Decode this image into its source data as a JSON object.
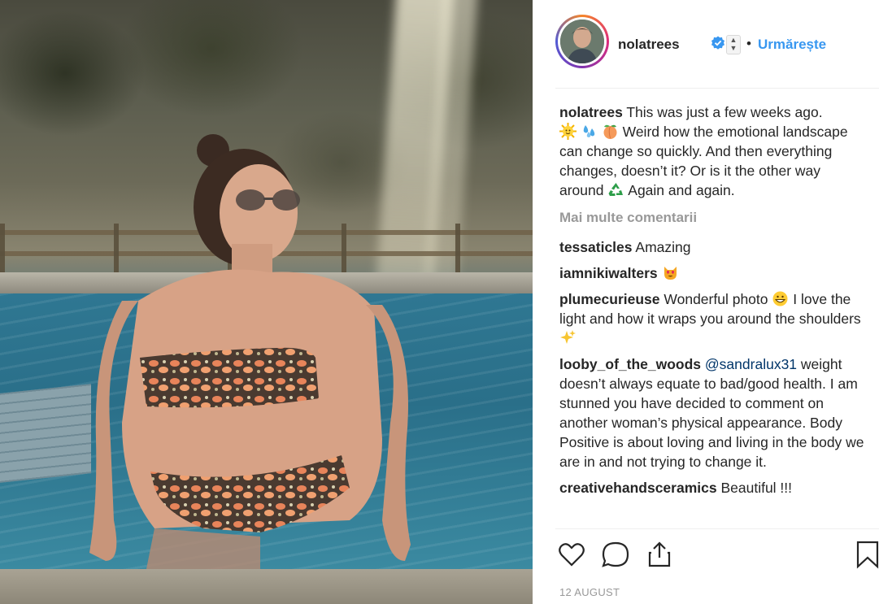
{
  "post": {
    "photo_alt": "",
    "author": {
      "username": "nolatrees",
      "verified": true,
      "follow_label": "Urmărește",
      "separator": "•"
    },
    "caption": {
      "username": "nolatrees",
      "text_1": "This was just a few weeks ago.",
      "text_2": "Weird how the emotional landscape can change so quickly. And then everything changes, doesn’t it? Or is it the other way around",
      "text_3": "Again and again."
    },
    "more_comments_label": "Mai multe comentarii",
    "comments": [
      {
        "username": "tessaticles",
        "text": "Amazing"
      },
      {
        "username": "iamnikiwalters",
        "text": ""
      },
      {
        "username": "plumecurieuse",
        "text_a": "Wonderful photo",
        "text_b": "I love the light and how it wraps you around the shoulders"
      },
      {
        "username": "looby_of_the_woods",
        "mention": "@sandralux31",
        "text": "weight doesn’t always equate to bad/good health. I am stunned you have decided to comment on another woman’s physical appearance. Body Positive is about loving and living in the body we are in and not trying to change it."
      },
      {
        "username": "creativehandsceramics",
        "text": "Beautiful !!!"
      }
    ],
    "date": "12 AUGUST",
    "icons": [
      "heart-icon",
      "comment-icon",
      "share-icon",
      "bookmark-icon"
    ],
    "colors": {
      "link": "#3897f0",
      "text": "#262626",
      "muted": "#999999",
      "mention": "#003569"
    }
  }
}
